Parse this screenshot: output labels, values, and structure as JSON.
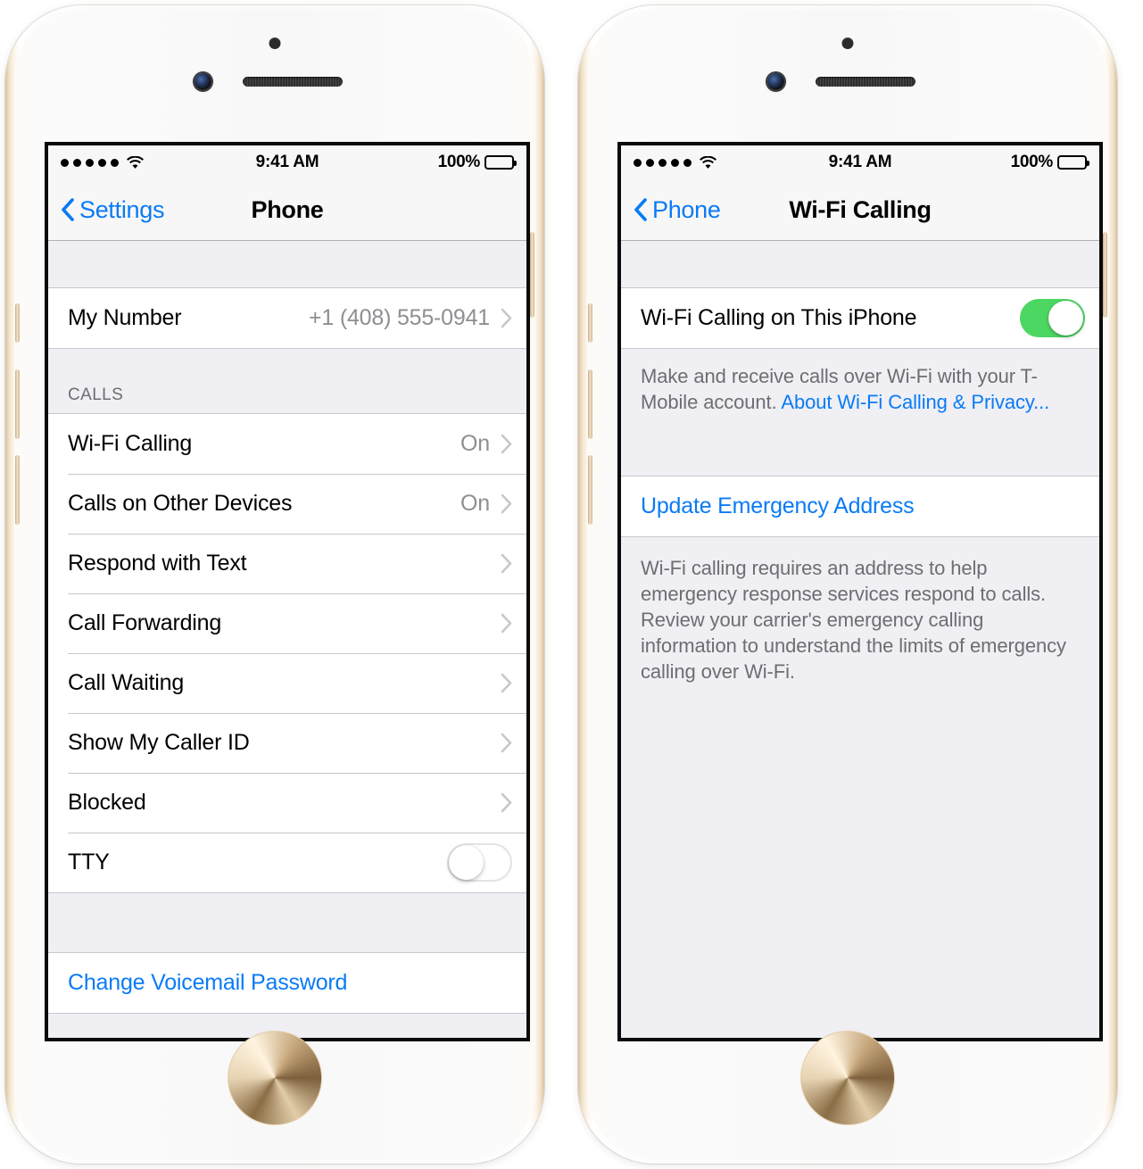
{
  "statusbar": {
    "signal_dots": 5,
    "wifi_icon": "wifi-icon",
    "time": "9:41 AM",
    "battery_percent": "100%",
    "battery_icon": "battery-full-icon"
  },
  "colors": {
    "accent_blue": "#0a7bf5",
    "toggle_on_green": "#4cd662",
    "screen_background": "#efeff4",
    "row_background": "#ffffff",
    "secondary_text": "#8e8e93",
    "separator": "#c8c7cc",
    "navbar_background": "#f7f7f7"
  },
  "phone_left": {
    "navbar": {
      "back_label": "Settings",
      "back_icon": "chevron-left-icon",
      "title": "Phone"
    },
    "group_my_number": [
      {
        "label": "My Number",
        "value": "+1 (408) 555-0941",
        "accessory": "chevron-right-icon"
      }
    ],
    "calls_section_header": "CALLS",
    "group_calls": [
      {
        "label": "Wi-Fi Calling",
        "value": "On",
        "accessory": "chevron-right-icon"
      },
      {
        "label": "Calls on Other Devices",
        "value": "On",
        "accessory": "chevron-right-icon"
      },
      {
        "label": "Respond with Text",
        "value": "",
        "accessory": "chevron-right-icon"
      },
      {
        "label": "Call Forwarding",
        "value": "",
        "accessory": "chevron-right-icon"
      },
      {
        "label": "Call Waiting",
        "value": "",
        "accessory": "chevron-right-icon"
      },
      {
        "label": "Show My Caller ID",
        "value": "",
        "accessory": "chevron-right-icon"
      },
      {
        "label": "Blocked",
        "value": "",
        "accessory": "chevron-right-icon"
      },
      {
        "label": "TTY",
        "value": "",
        "accessory": "toggle",
        "toggle_state": "off"
      }
    ],
    "group_voicemail": [
      {
        "label": "Change Voicemail Password",
        "value": "",
        "accessory": "none"
      }
    ]
  },
  "phone_right": {
    "navbar": {
      "back_label": "Phone",
      "back_icon": "chevron-left-icon",
      "title": "Wi-Fi Calling"
    },
    "group_toggle": [
      {
        "label": "Wi-Fi Calling on This iPhone",
        "accessory": "toggle",
        "toggle_state": "on"
      }
    ],
    "note_one": {
      "text_before": "Make and receive calls over Wi-Fi with your T-Mobile account. ",
      "link_text": "About Wi-Fi Calling & Privacy..."
    },
    "group_address": [
      {
        "label": "Update Emergency Address",
        "accessory": "none"
      }
    ],
    "note_two": {
      "text": "Wi-Fi calling requires an address to help emergency response services respond to calls. Review your carrier's emergency calling information to understand the limits of emergency calling over Wi-Fi."
    }
  }
}
